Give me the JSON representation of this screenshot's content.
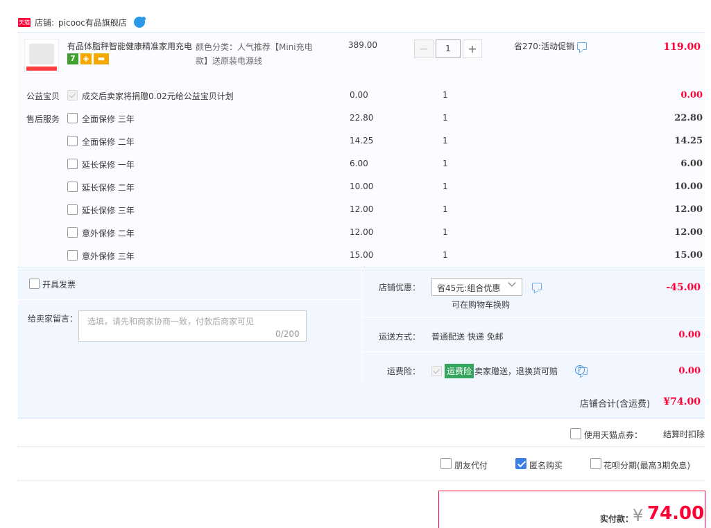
{
  "store": {
    "label": "店铺:",
    "name": "picooc有品旗舰店"
  },
  "item": {
    "title": "有品体脂秤智能健康精准家用充电",
    "sku": "颜色分类：人气推荐【Mini充电款】送原装电源线",
    "unit_price": "389.00",
    "quantity": "1",
    "minus": "−",
    "plus": "+",
    "promo": "省270:活动促销",
    "total": "119.00"
  },
  "services": [
    {
      "label": "公益宝贝",
      "name": "成交后卖家将捐赠0.02元给公益宝贝计划",
      "price": "0.00",
      "qty": "1",
      "total": "0.00",
      "red": true,
      "disabled": true
    },
    {
      "label": "售后服务",
      "name": "全面保修 三年",
      "price": "22.80",
      "qty": "1",
      "total": "22.80"
    },
    {
      "label": "",
      "name": "全面保修 二年",
      "price": "14.25",
      "qty": "1",
      "total": "14.25"
    },
    {
      "label": "",
      "name": "延长保修 一年",
      "price": "6.00",
      "qty": "1",
      "total": "6.00"
    },
    {
      "label": "",
      "name": "延长保修 二年",
      "price": "10.00",
      "qty": "1",
      "total": "10.00"
    },
    {
      "label": "",
      "name": "延长保修 三年",
      "price": "12.00",
      "qty": "1",
      "total": "12.00"
    },
    {
      "label": "",
      "name": "意外保修 二年",
      "price": "12.00",
      "qty": "1",
      "total": "12.00"
    },
    {
      "label": "",
      "name": "意外保修 三年",
      "price": "15.00",
      "qty": "1",
      "total": "15.00"
    }
  ],
  "order": {
    "invoice_label": "开具发票",
    "message_label": "给卖家留言：",
    "message_placeholder": "选填，请先和商家协商一致，付款后商家可见",
    "message_count": "0/200",
    "coupon_label": "店铺优惠：",
    "coupon_value": "省45元:组合优惠",
    "coupon_hint": "可在购物车换购",
    "coupon_total": "-45.00",
    "shipping_label": "运送方式：",
    "shipping_value": "普通配送 快递 免邮",
    "shipping_total": "0.00",
    "insurance_label": "运费险：",
    "insurance_tag": "运费险",
    "insurance_desc": "卖家赠送，退换货可赔",
    "insurance_total": "0.00",
    "subtotal_label": "店铺合计(含运费)",
    "subtotal_value": "¥74.00"
  },
  "options": {
    "tmall_points": "使用天猫点券：",
    "points_note": "结算时扣除",
    "friend_pay": "朋友代付",
    "anonymous": "匿名购买",
    "huabei": "花呗分期(最高3期免息)"
  },
  "payment": {
    "label": "实付款：",
    "currency": "¥",
    "amount": "74.00"
  },
  "colors": {
    "accent_red": "#ff0036",
    "bg_blue": "#f2f7ff",
    "check_blue": "#3b7ee5"
  }
}
